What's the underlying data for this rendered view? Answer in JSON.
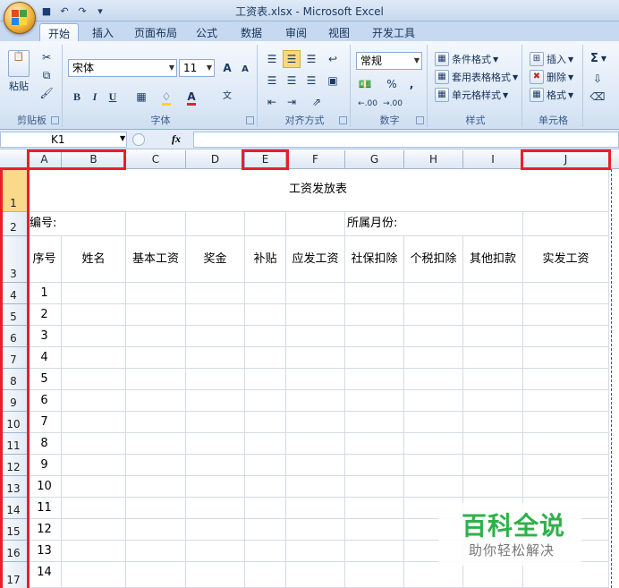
{
  "window": {
    "title": "工资表.xlsx - Microsoft Excel"
  },
  "tabs": [
    "开始",
    "插入",
    "页面布局",
    "公式",
    "数据",
    "审阅",
    "视图",
    "开发工具"
  ],
  "ribbon": {
    "clipboard": {
      "label": "剪贴板",
      "paste": "粘贴"
    },
    "font": {
      "label": "字体",
      "name": "宋体",
      "size": "11",
      "bold": "B",
      "italic": "I",
      "underline": "U",
      "grow": "A",
      "shrink": "A",
      "phonetic": "文"
    },
    "alignment": {
      "label": "对齐方式"
    },
    "number": {
      "label": "数字",
      "format": "常规",
      "percent": "%",
      "comma": ",",
      "inc_decimal": ".00",
      "dec_decimal": ".00"
    },
    "styles": {
      "label": "样式",
      "conditional": "条件格式",
      "table": "套用表格格式",
      "cell": "单元格样式"
    },
    "cells": {
      "label": "单元格",
      "insert": "插入",
      "delete": "删除",
      "format": "格式"
    },
    "editing": {
      "sum": "Σ"
    }
  },
  "formula_bar": {
    "name_box": "K1",
    "fx": "fx",
    "formula": ""
  },
  "columns": [
    "A",
    "B",
    "C",
    "D",
    "E",
    "F",
    "G",
    "H",
    "I",
    "J"
  ],
  "rows": [
    "1",
    "2",
    "3",
    "4",
    "5",
    "6",
    "7",
    "8",
    "9",
    "10",
    "11",
    "12",
    "13",
    "14",
    "15",
    "16",
    "17"
  ],
  "sheet": {
    "title": "工资发放表",
    "number_label": "编号:",
    "month_label": "所属月份:",
    "headers": [
      "序号",
      "姓名",
      "基本工资",
      "奖金",
      "补贴",
      "应发工资",
      "社保扣除",
      "个税扣除",
      "其他扣款",
      "实发工资"
    ],
    "serials": [
      "1",
      "2",
      "3",
      "4",
      "5",
      "6",
      "7",
      "8",
      "9",
      "10",
      "11",
      "12",
      "13",
      "14"
    ]
  },
  "watermark": {
    "main": "百科全说",
    "sub": "助你轻松解决"
  },
  "colors": {
    "highlight_border": "#e8202a",
    "watermark_green": "#2fb14a"
  }
}
